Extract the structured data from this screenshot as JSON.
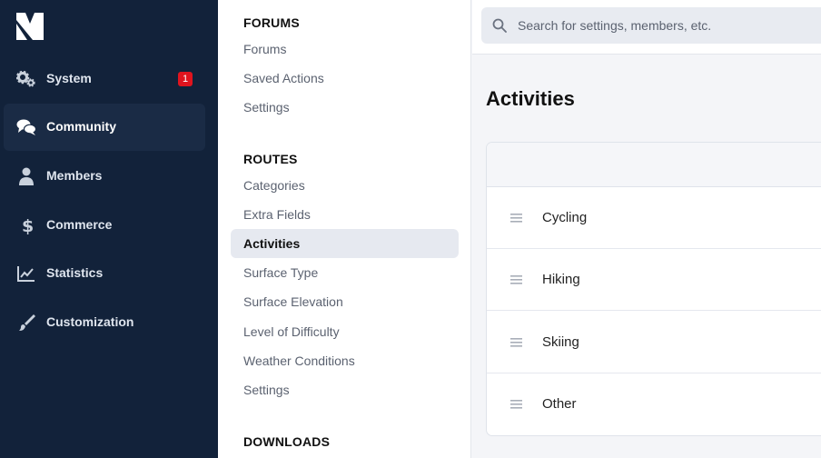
{
  "nav": {
    "items": [
      {
        "label": "System",
        "icon": "gears-icon",
        "badge": "1"
      },
      {
        "label": "Community",
        "icon": "chat-bubbles-icon"
      },
      {
        "label": "Members",
        "icon": "user-icon"
      },
      {
        "label": "Commerce",
        "icon": "dollar-icon"
      },
      {
        "label": "Statistics",
        "icon": "line-chart-icon"
      },
      {
        "label": "Customization",
        "icon": "paintbrush-icon"
      }
    ],
    "active": "Community"
  },
  "subnav": {
    "forums": {
      "heading": "FORUMS",
      "items": [
        "Forums",
        "Saved Actions",
        "Settings"
      ]
    },
    "routes": {
      "heading": "ROUTES",
      "items": [
        "Categories",
        "Extra Fields",
        "Activities",
        "Surface Type",
        "Surface Elevation",
        "Level of Difficulty",
        "Weather Conditions",
        "Settings"
      ]
    },
    "downloads": {
      "heading": "DOWNLOADS"
    },
    "active": "Activities"
  },
  "search": {
    "placeholder": "Search for settings, members, etc."
  },
  "main": {
    "title": "Activities",
    "rows": [
      "Cycling",
      "Hiking",
      "Skiing",
      "Other"
    ]
  },
  "colors": {
    "nav_bg": "#12223a",
    "nav_active": "#1a2b45",
    "badge": "#e0141e",
    "subnav_active": "#e6e9f0"
  }
}
